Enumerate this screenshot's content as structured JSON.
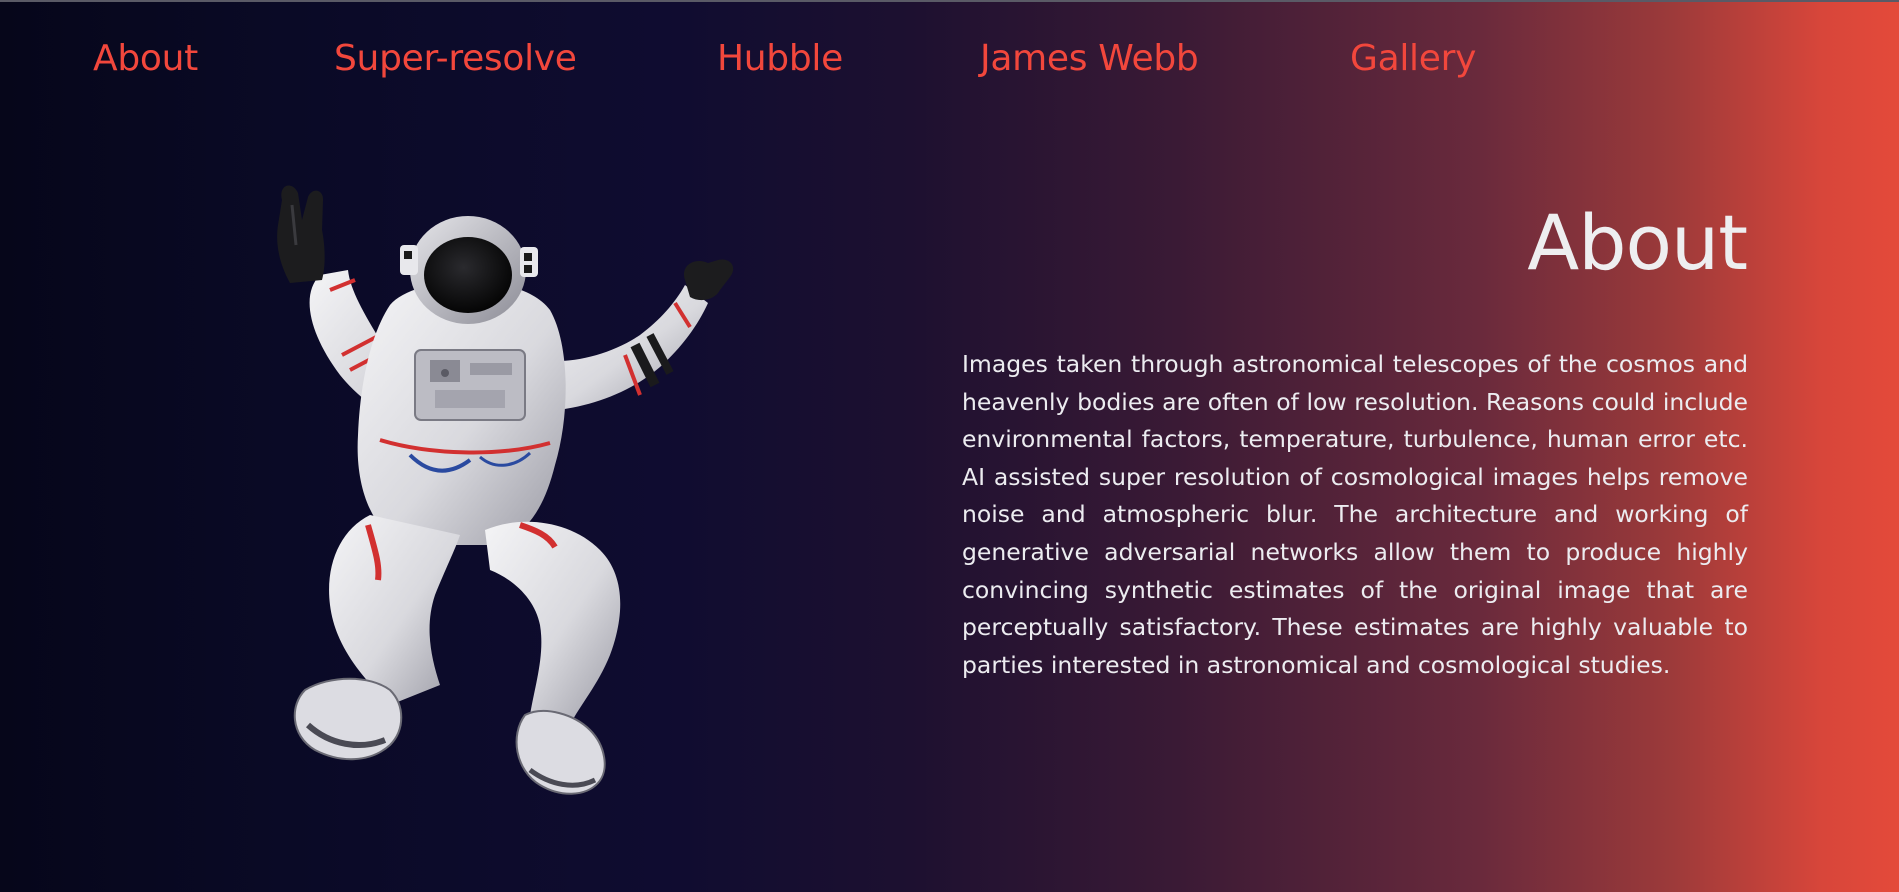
{
  "nav": {
    "items": [
      {
        "label": "About"
      },
      {
        "label": "Super-resolve"
      },
      {
        "label": "Hubble"
      },
      {
        "label": "James Webb"
      },
      {
        "label": "Gallery"
      }
    ]
  },
  "hero": {
    "image": "astronaut-image",
    "title": "About",
    "body": "Images taken through astronomical telescopes of the cosmos and heavenly bodies are often of low resolution. Reasons could include environmental factors, temperature, turbulence, human error etc. AI assisted super resolution of cosmological images helps remove noise and atmospheric blur. The architecture and working of generative adversarial networks allow them to produce highly convincing synthetic estimates of the original image that are perceptually satisfactory. These estimates are highly valuable to parties interested in astronomical and cosmological studies."
  },
  "colors": {
    "nav_link": "#f2473c",
    "text": "#ececf0",
    "bg_left": "#06061a",
    "bg_right": "#e44a3a"
  }
}
